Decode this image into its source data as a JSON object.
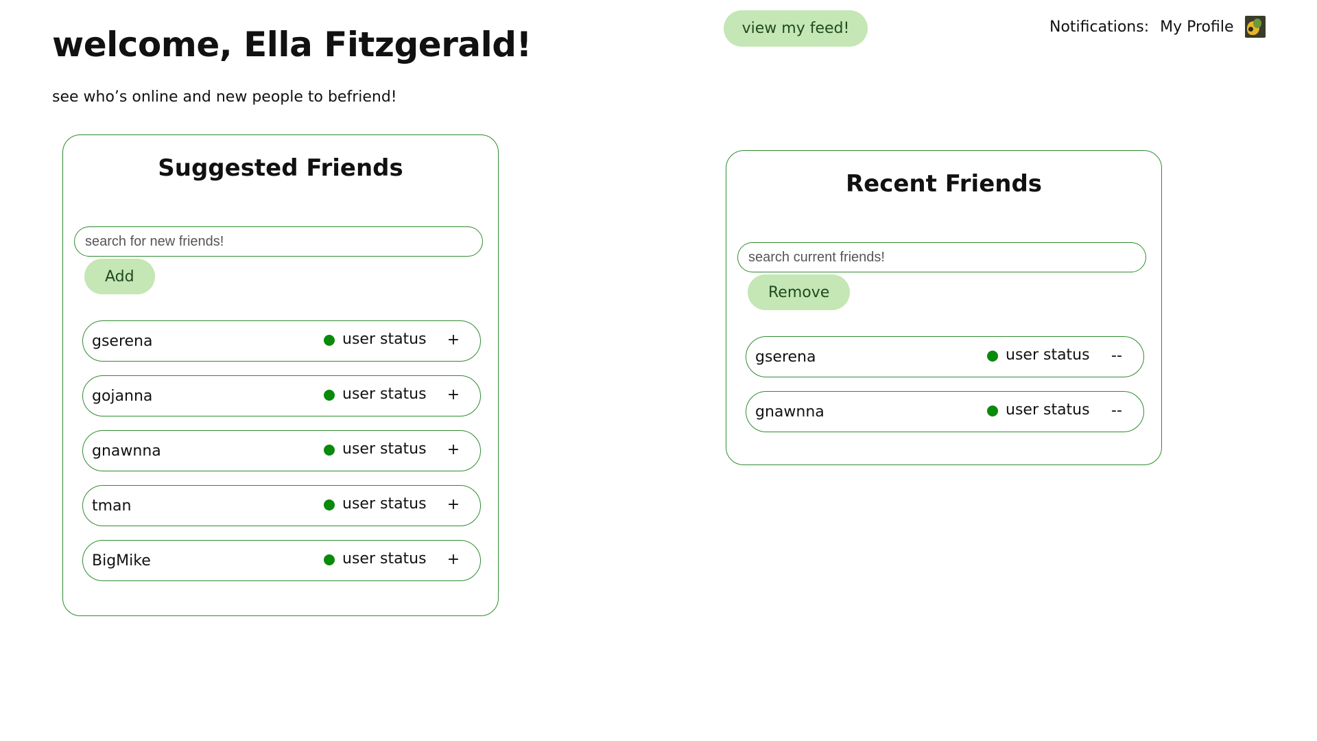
{
  "header": {
    "welcome_title": "welcome, Ella Fitzgerald!",
    "subtitle": "see who’s online and new people to befriend!",
    "feed_button_label": "view my feed!",
    "notifications_label": "Notifications:",
    "profile_label": "My Profile",
    "avatar_icon": "profile-avatar-image"
  },
  "suggested": {
    "title": "Suggested Friends",
    "search_placeholder": "search for new friends!",
    "search_value": "",
    "action_label": "Add",
    "items": [
      {
        "name": "gserena",
        "status": "user status",
        "action": "+"
      },
      {
        "name": "gojanna",
        "status": "user status",
        "action": "+"
      },
      {
        "name": "gnawnna",
        "status": "user status",
        "action": "+"
      },
      {
        "name": "tman",
        "status": "user status",
        "action": "+"
      },
      {
        "name": "BigMike",
        "status": "user status",
        "action": "+"
      }
    ]
  },
  "recent": {
    "title": "Recent Friends",
    "search_placeholder": "search current friends!",
    "search_value": "",
    "action_label": "Remove",
    "items": [
      {
        "name": "gserena",
        "status": "user status",
        "action": "--"
      },
      {
        "name": "gnawnna",
        "status": "user status",
        "action": "--"
      }
    ]
  },
  "colors": {
    "accent_border": "#2e8b2e",
    "button_fill": "#c5e6b5",
    "online_dot": "#0a8a0a"
  }
}
